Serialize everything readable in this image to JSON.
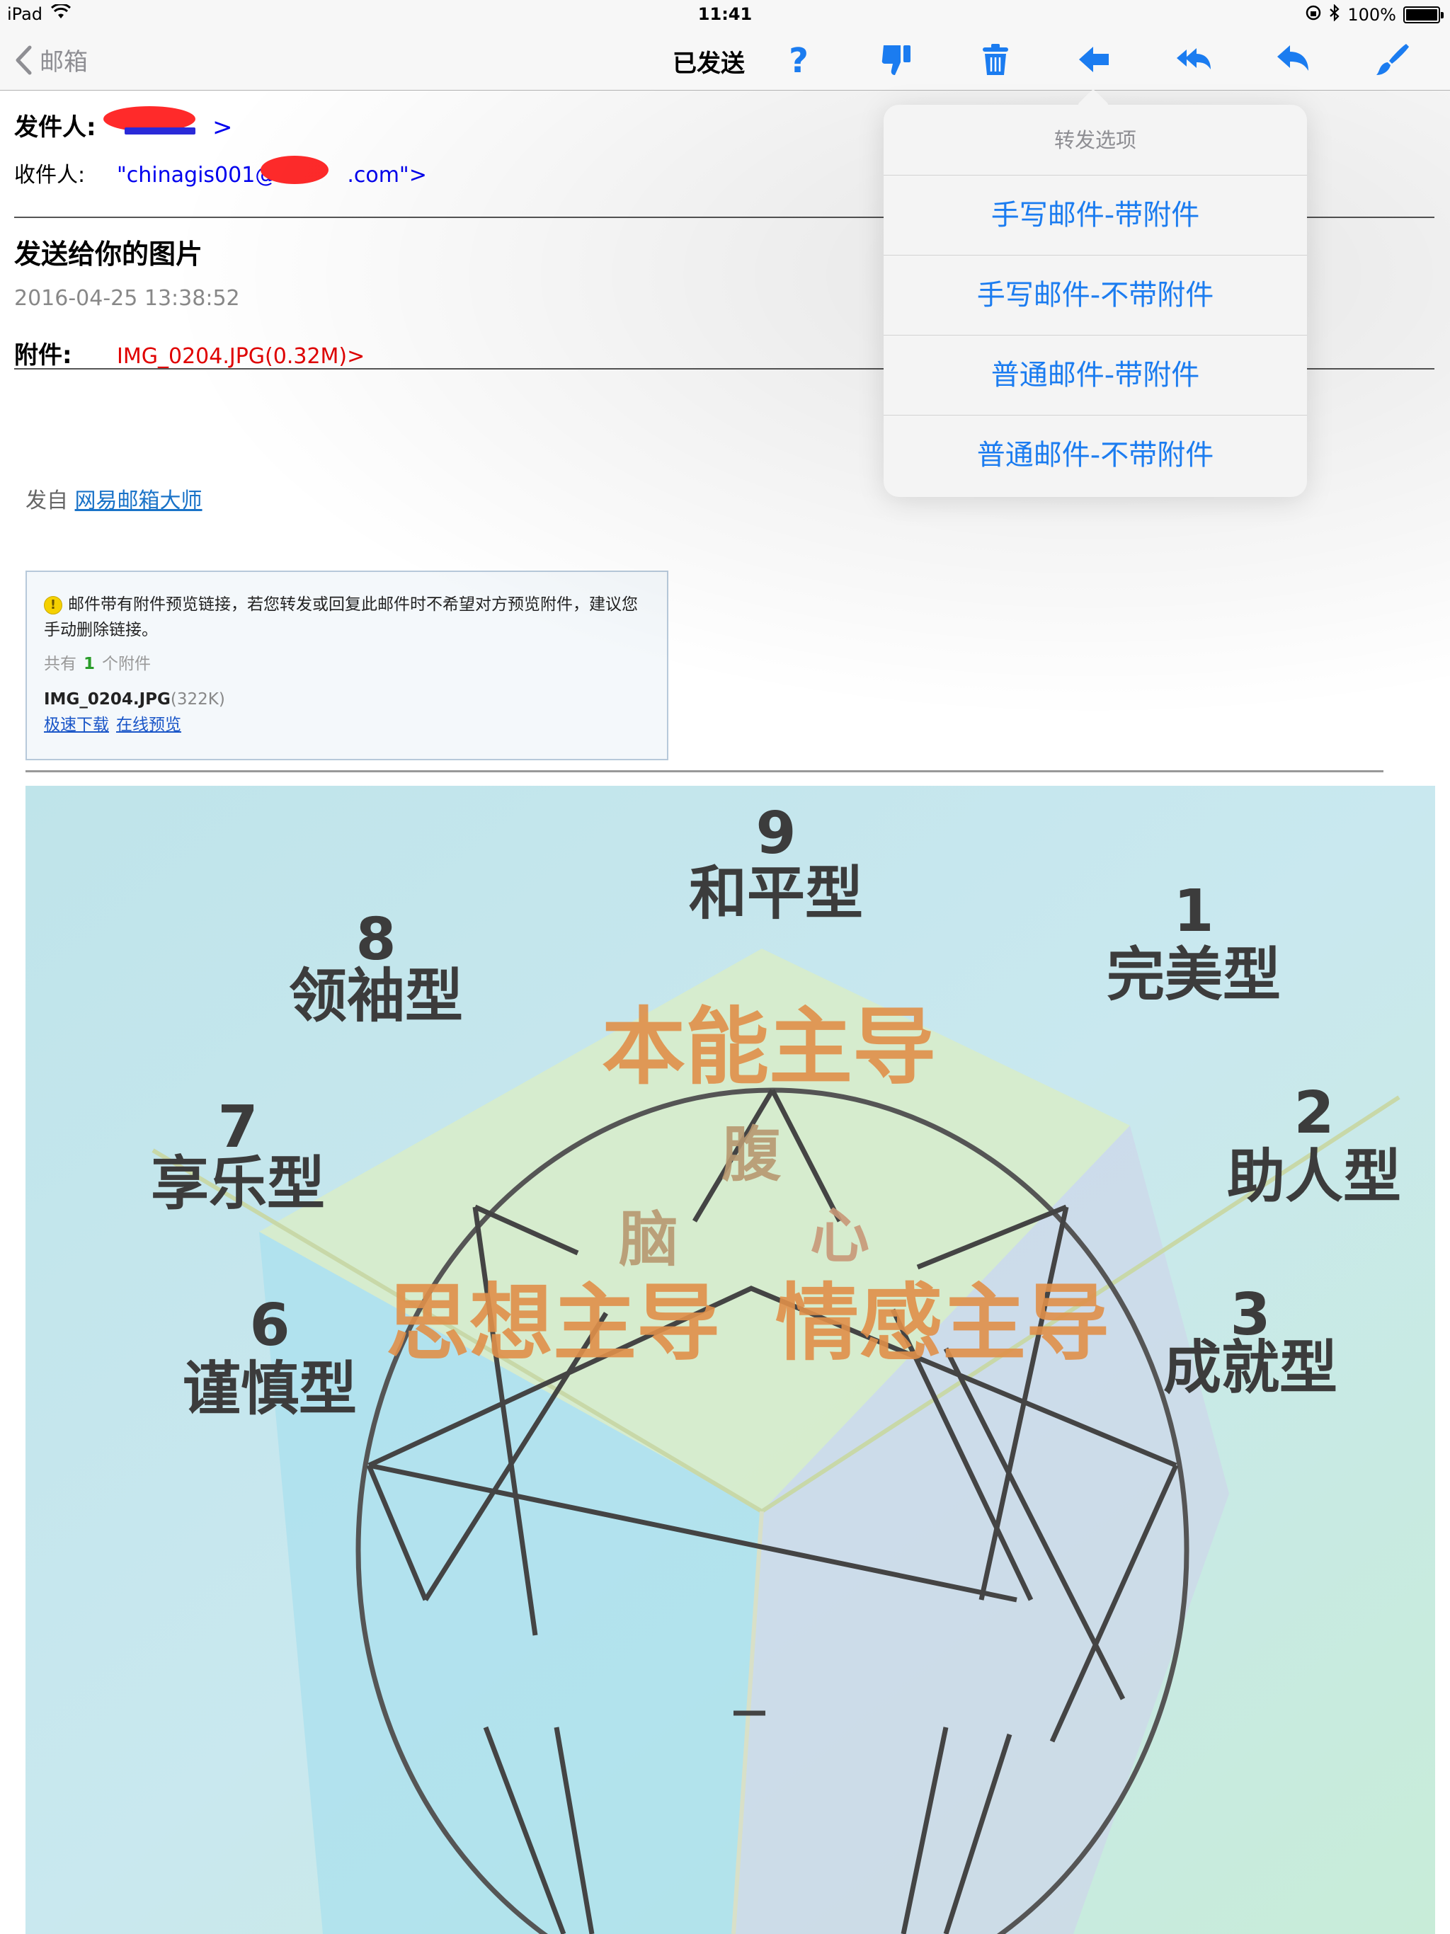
{
  "status_bar": {
    "device": "iPad",
    "time": "11:41",
    "battery": "100%"
  },
  "nav": {
    "back_label": "邮箱",
    "title": "已发送",
    "tools": [
      "help-icon",
      "thumbs-down-icon",
      "trash-icon",
      "forward-arrow-icon",
      "reply-all-icon",
      "reply-icon",
      "brush-icon"
    ]
  },
  "header": {
    "from_label": "发件人:",
    "from_value": ">",
    "to_label": "收件人:",
    "to_value_prefix": "\"chinagis001@",
    "to_value_suffix": ".com\">",
    "subject": "发送给你的图片",
    "date": "2016-04-25 13:38:52",
    "attachment_label": "附件:",
    "attachment_value": "IMG_0204.JPG(0.32M)>"
  },
  "body": {
    "sent_from_prefix": "发自",
    "sent_from_link": "网易邮箱大师",
    "notice": {
      "warn_glyph": "!",
      "text": "邮件带有附件预览链接，若您转发或回复此邮件时不希望对方预览附件，建议您手动删除链接。",
      "count_prefix": "共有",
      "count": "1",
      "count_suffix": "个附件",
      "file_name": "IMG_0204.JPG",
      "file_size": "(322K)",
      "download_link": "极速下载",
      "preview_link": "在线预览"
    }
  },
  "photo": {
    "types": [
      {
        "num": "9",
        "name": "和平型"
      },
      {
        "num": "1",
        "name": "完美型"
      },
      {
        "num": "2",
        "name": "助人型"
      },
      {
        "num": "3",
        "name": "成就型"
      },
      {
        "num": "6",
        "name": "谨慎型"
      },
      {
        "num": "7",
        "name": "享乐型"
      },
      {
        "num": "8",
        "name": "领袖型"
      }
    ],
    "center_top": "本能主导",
    "belly": "腹",
    "brain": "脑",
    "heart": "心",
    "thinking": "思想主导",
    "feeling": "情感主导"
  },
  "popover": {
    "title": "转发选项",
    "items": [
      "手写邮件-带附件",
      "手写邮件-不带附件",
      "普通邮件-带附件",
      "普通邮件-不带附件"
    ]
  }
}
